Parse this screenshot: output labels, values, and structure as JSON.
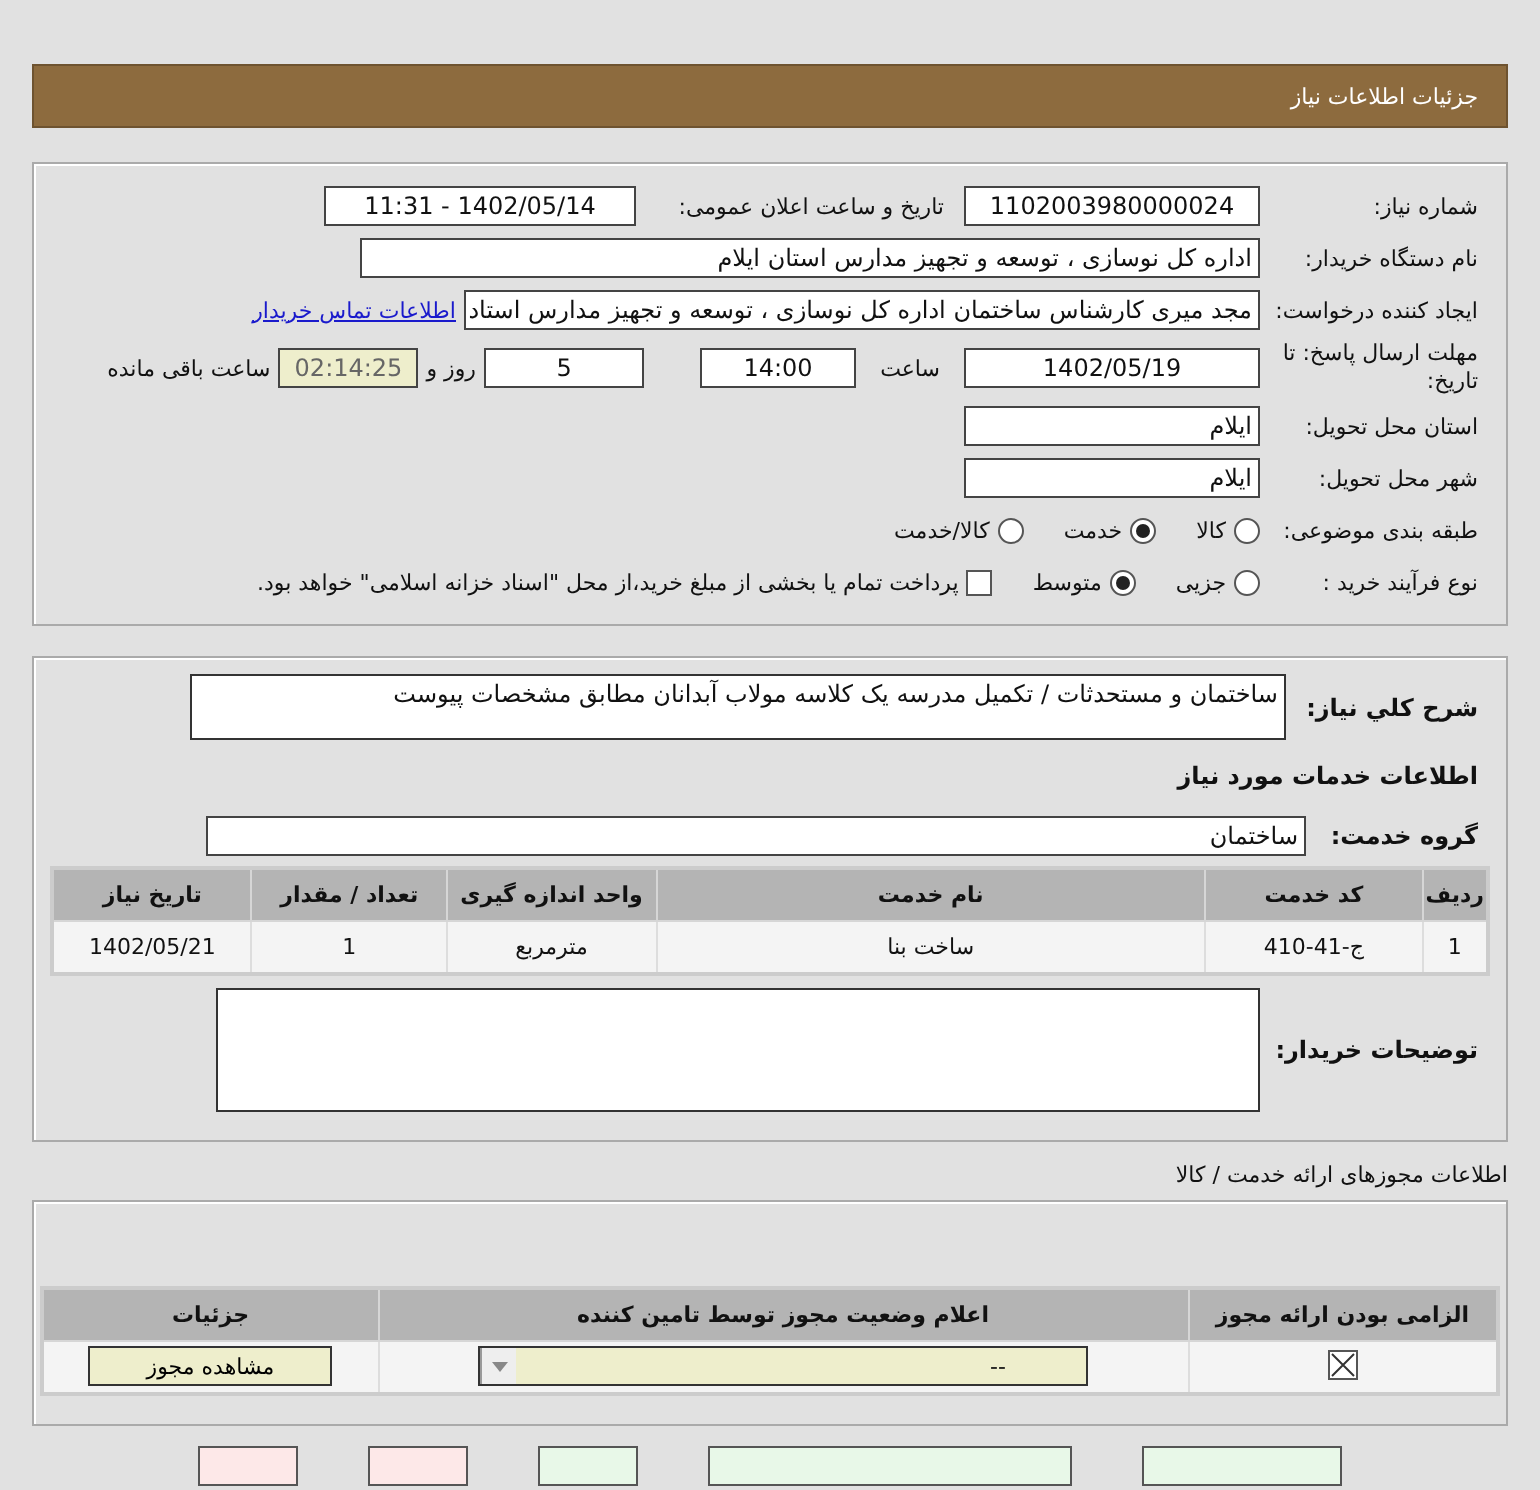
{
  "header": {
    "title": "جزئیات اطلاعات نیاز"
  },
  "details": {
    "need_number": {
      "label": "شماره نیاز:",
      "value": "1102003980000024"
    },
    "announce": {
      "label": "تاریخ و ساعت اعلان عمومی:",
      "value": "1402/05/14 - 11:31"
    },
    "buyer": {
      "label": "نام دستگاه خریدار:",
      "value": "اداره کل نوسازی ، توسعه و تجهیز مدارس استان ایلام"
    },
    "creator": {
      "label": "ایجاد کننده درخواست:",
      "value": "مجد میری کارشناس ساختمان اداره کل نوسازی ، توسعه و تجهیز مدارس استاد",
      "link": "اطلاعات تماس خریدار"
    },
    "deadline": {
      "label": "مهلت ارسال پاسخ: تا تاریخ:",
      "date": "1402/05/19",
      "time_label": "ساعت",
      "time": "14:00",
      "days": "5",
      "days_label": "روز و",
      "remaining": "02:14:25",
      "remaining_label": "ساعت باقی مانده"
    },
    "province": {
      "label": "استان محل تحویل:",
      "value": "ایلام"
    },
    "city": {
      "label": "شهر محل تحویل:",
      "value": "ایلام"
    },
    "category": {
      "label": "طبقه بندی موضوعی:",
      "options": [
        {
          "label": "کالا",
          "selected": false
        },
        {
          "label": "خدمت",
          "selected": true
        },
        {
          "label": "کالا/خدمت",
          "selected": false
        }
      ]
    },
    "process": {
      "label": "نوع فرآیند خرید :",
      "options": [
        {
          "label": "جزیی",
          "selected": false
        },
        {
          "label": "متوسط",
          "selected": true
        }
      ],
      "payment": {
        "label": "پرداخت تمام یا بخشی از مبلغ خرید،از محل \"اسناد خزانه اسلامی\" خواهد بود.",
        "checked": false
      }
    }
  },
  "need": {
    "description_label": "شرح کلي نیاز:",
    "description": "ساختمان و مستحدثات / تکمیل مدرسه یک کلاسه مولاب آبدانان مطابق مشخصات پیوست",
    "services_title": "اطلاعات خدمات مورد نیاز",
    "group_label": "گروه خدمت:",
    "group": "ساختمان",
    "table": {
      "columns": [
        "ردیف",
        "کد خدمت",
        "نام خدمت",
        "واحد اندازه گیری",
        "تعداد / مقدار",
        "تاریخ نیاز"
      ],
      "rows": [
        [
          "1",
          "ج-41-410",
          "ساخت بنا",
          "مترمربع",
          "1",
          "1402/05/21"
        ]
      ]
    },
    "notes_label": "توضیحات خریدار:"
  },
  "permits": {
    "title": "اطلاعات مجوزهای ارائه خدمت / کالا",
    "columns": [
      "الزامی بودن ارائه مجوز",
      "اعلام وضعیت مجوز توسط تامین کننده",
      "جزئیات"
    ],
    "rows": [
      {
        "required": true,
        "status": "--",
        "action": "مشاهده مجوز"
      }
    ]
  }
}
